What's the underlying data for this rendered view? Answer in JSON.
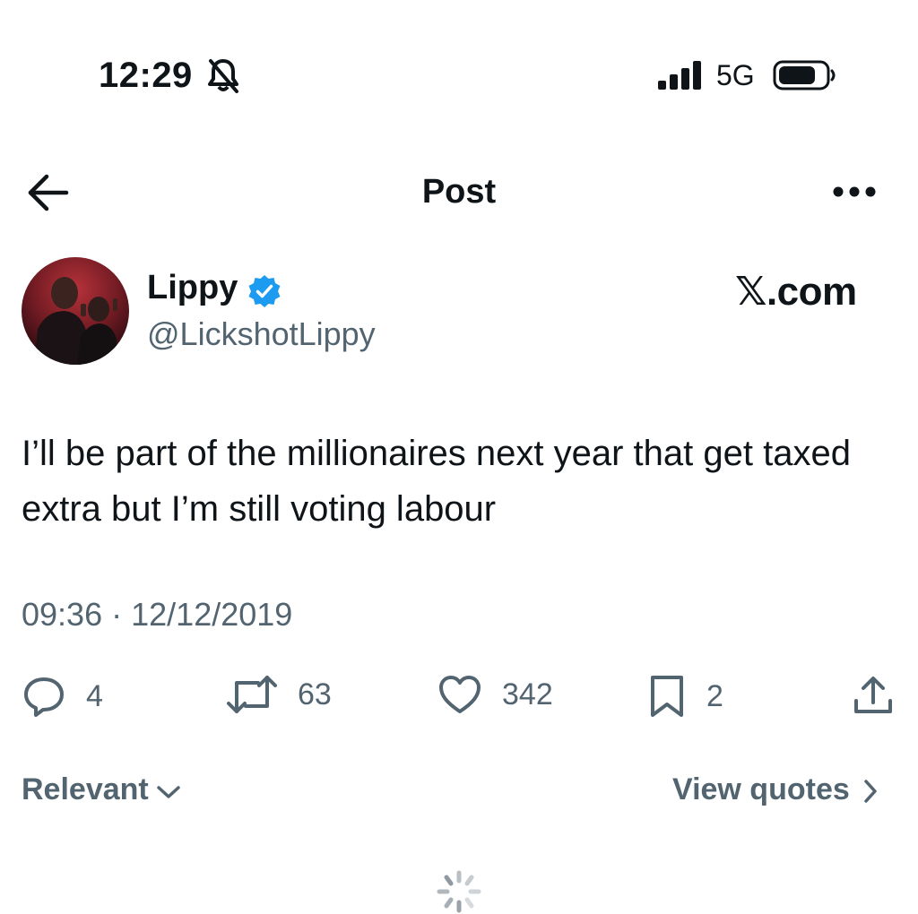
{
  "status_bar": {
    "time": "12:29",
    "network": "5G",
    "icons": [
      "bell-muted-icon",
      "signal-icon",
      "battery-icon"
    ]
  },
  "nav": {
    "title": "Post",
    "icons": [
      "back-arrow-icon",
      "more-icon"
    ]
  },
  "post": {
    "author_name": "Lippy",
    "handle": "@LickshotLippy",
    "brand": "𝕏.com",
    "text": "I’ll be part of the millionaires next year that get taxed extra but I’m still voting labour",
    "time": "09:36",
    "separator": "·",
    "date": "12/12/2019"
  },
  "actions": {
    "reply_count": "4",
    "retweet_count": "63",
    "like_count": "342",
    "bookmark_count": "2",
    "icons": [
      "reply-icon",
      "retweet-icon",
      "like-icon",
      "bookmark-icon",
      "share-icon"
    ]
  },
  "footer": {
    "sort_label": "Relevant",
    "view_quotes_label": "View quotes"
  },
  "colors": {
    "text": "#0f1419",
    "secondary": "#536471",
    "verified": "#1d9bf0"
  }
}
